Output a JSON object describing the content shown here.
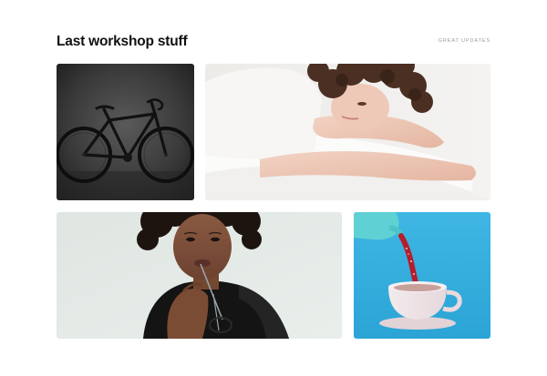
{
  "header": {
    "title": "Last workshop stuff",
    "link_label": "GREAT UPDATES"
  },
  "gallery": {
    "tiles": [
      {
        "subject": "black road bicycle on dark background"
      },
      {
        "subject": "woman with curly hair resting on white pillow"
      },
      {
        "subject": "woman holding glasses to her lips"
      },
      {
        "subject": "teapot pouring red tea into white cup on blue background"
      }
    ]
  }
}
